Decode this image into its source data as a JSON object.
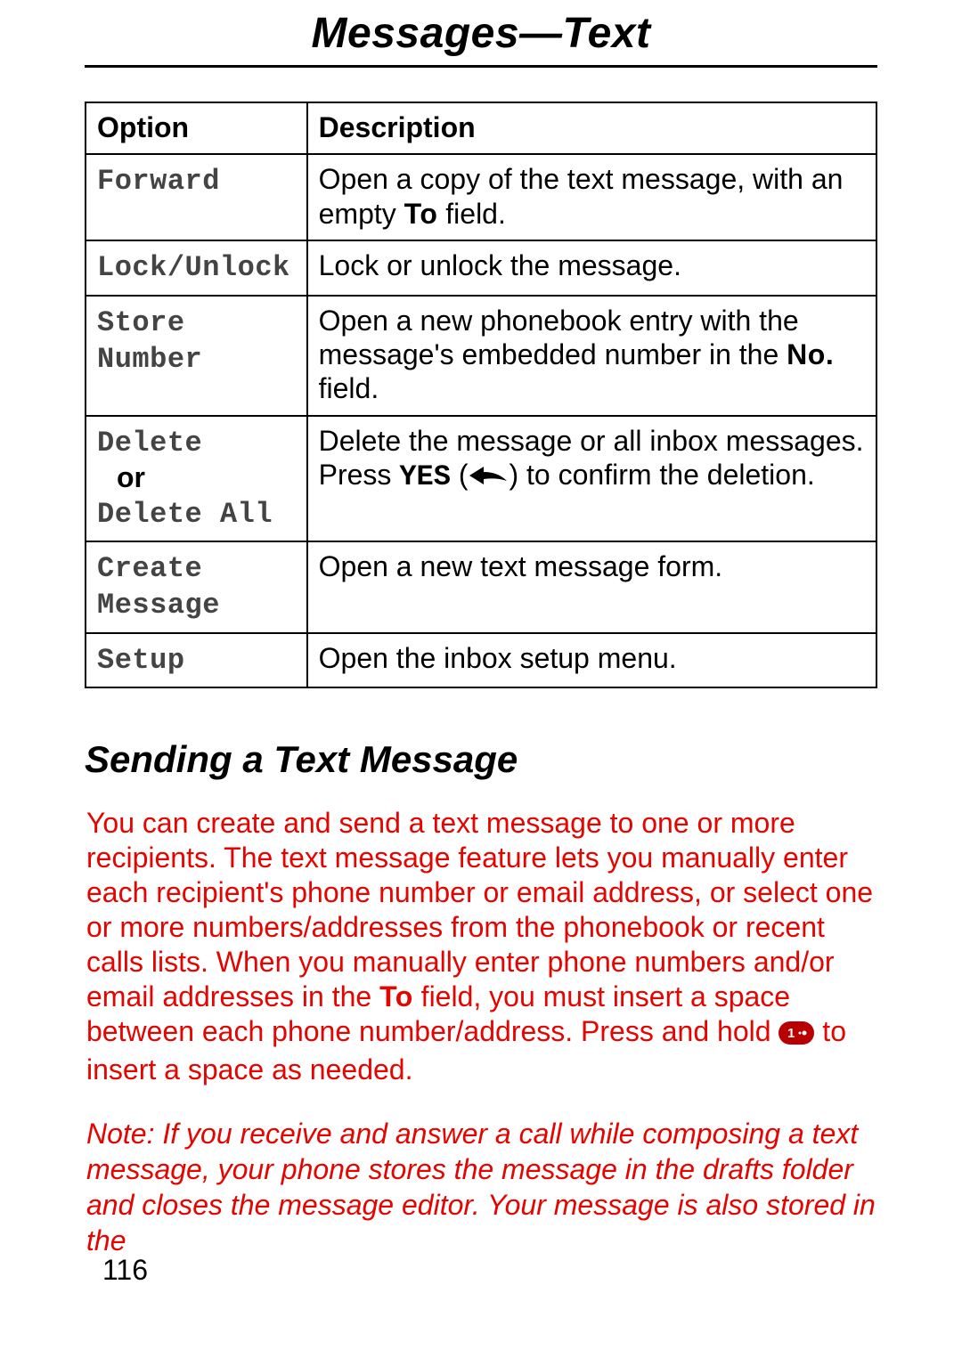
{
  "header": {
    "title": "Messages—Text"
  },
  "table": {
    "headers": {
      "option": "Option",
      "description": "Description"
    },
    "rows": {
      "forward": {
        "option": "Forward",
        "desc_p1": "Open a copy of the text message, with an empty ",
        "desc_bold": "To",
        "desc_p2": " field."
      },
      "lock": {
        "option": "Lock/Unlock",
        "desc": "Lock or unlock the message."
      },
      "store": {
        "option": "Store Number",
        "desc_p1": "Open a new phonebook entry with the message's embedded number in the ",
        "desc_bold": "No.",
        "desc_p2": " field."
      },
      "delete": {
        "option_a": "Delete",
        "or": "or",
        "option_b": "Delete All",
        "desc_line1": "Delete the message or all inbox messages.",
        "desc_line2_p1": "Press ",
        "desc_line2_yes": "YES",
        "desc_line2_p2": " (",
        "desc_line2_p3": ") to confirm the deletion."
      },
      "create": {
        "option": "Create Message",
        "desc": "Open a new text message form."
      },
      "setup": {
        "option": "Setup",
        "desc": "Open the inbox setup menu."
      }
    }
  },
  "section": {
    "heading": "Sending a Text Message"
  },
  "body": {
    "p1a": "You can create and send a text message to one or more recipients. The text message feature lets you manually enter each recipient's phone number or email address, or select one or more numbers/addresses from the phonebook or recent calls lists. When you manually enter phone numbers and/or email addresses in the ",
    "p1bold": "To",
    "p1b": " field, you must insert a space between each phone number/address. Press and hold ",
    "p1c": " to insert a space as needed."
  },
  "note": {
    "label": "Note:",
    "text": "  If you receive and answer a call while composing a text message, your phone stores the message in the drafts folder and closes the message editor. Your message is also stored in the"
  },
  "page_number": "116"
}
